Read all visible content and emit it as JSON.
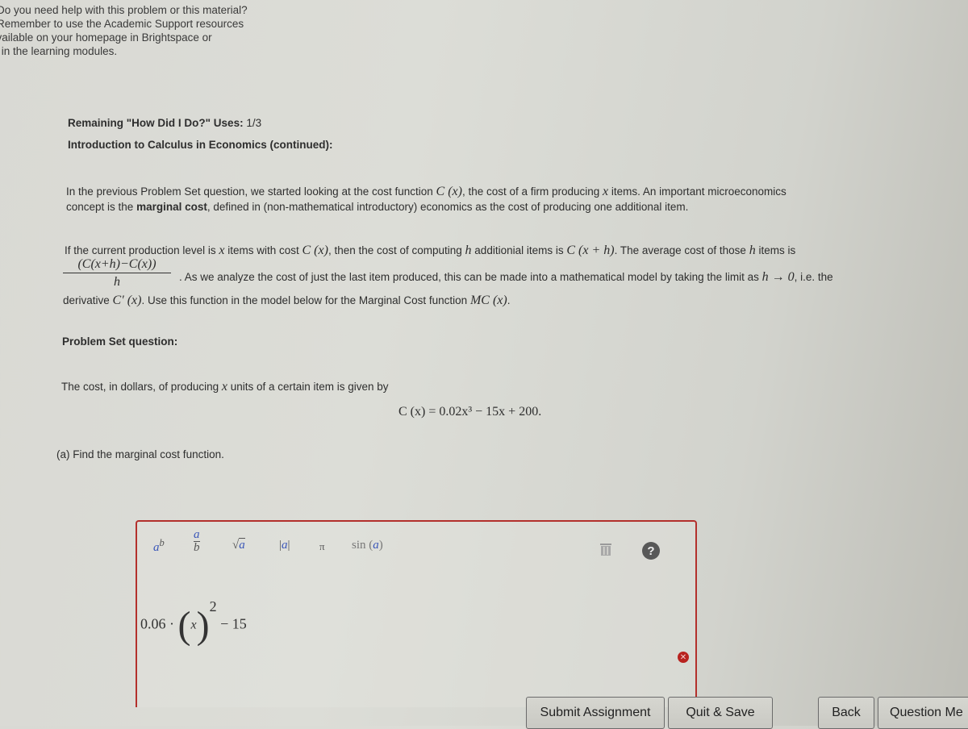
{
  "help_notice": {
    "lines": [
      "Do you need help with this problem or this material?",
      "Remember to use the Academic Support resources",
      "available on your homepage in Brightspace or",
      "or in the learning modules."
    ]
  },
  "header": {
    "remaining_label": "Remaining \"How Did I Do?\" Uses:",
    "remaining_value": "1/3",
    "intro_title": "Introduction to Calculus in Economics (continued):"
  },
  "intro": {
    "p1_a": "In the previous Problem Set question, we started looking at the cost function ",
    "p1_math1": "C (x)",
    "p1_b": ", the cost of a firm producing ",
    "p1_math2": "x",
    "p1_c": " items. An important microeconomics",
    "p2_a": "concept is the ",
    "p2_bold": "marginal cost",
    "p2_b": ", defined in (non-mathematical introductory) economics as the cost of producing one additional item.",
    "p3_a": "If the current production level is ",
    "p3_m1": "x",
    "p3_b": " items with cost ",
    "p3_m2": "C (x)",
    "p3_c": ", then the cost of computing ",
    "p3_m3": "h",
    "p3_d": " additionial items is ",
    "p3_m4": "C (x + h)",
    "p3_e": ". The average cost of those ",
    "p3_m5": "h",
    "p3_f": " items is",
    "frac_num": "(C(x+h)−C(x))",
    "frac_den": "h",
    "p4_a": ". As we analyze the cost of just the last item produced, this can be made into a mathematical model by taking the limit as ",
    "p4_m1": "h → 0",
    "p4_b": ", i.e. the",
    "p5_a": "derivative ",
    "p5_m1": "C′ (x)",
    "p5_b": ". Use this function in the model below for the Marginal Cost function ",
    "p5_m2": "MC (x)",
    "p5_c": "."
  },
  "problem": {
    "section_title": "Problem Set question:",
    "statement_a": "The cost, in dollars, of producing ",
    "statement_m": "x",
    "statement_b": " units of a certain item is given by",
    "formula": "C (x) = 0.02x³ − 15x + 200.",
    "part_a": "(a) Find the marginal cost function."
  },
  "math_toolbar": {
    "power": {
      "base": "a",
      "exp": "b"
    },
    "fraction": {
      "num": "a",
      "den": "b"
    },
    "sqrt": {
      "symbol": "√",
      "arg": "a"
    },
    "abs": {
      "arg": "a"
    },
    "pi": "π",
    "sin": {
      "fn": "sin",
      "arg": "a"
    }
  },
  "answer": {
    "coef": "0.06 ·",
    "var": "x",
    "exp": "2",
    "tail": "− 15",
    "status": "incorrect"
  },
  "buttons": {
    "submit": "Submit Assignment",
    "quit_save": "Quit & Save",
    "back": "Back",
    "question_menu": "Question Me"
  },
  "colors": {
    "error_border": "#b3302c",
    "math_blue": "#3a56b8"
  }
}
